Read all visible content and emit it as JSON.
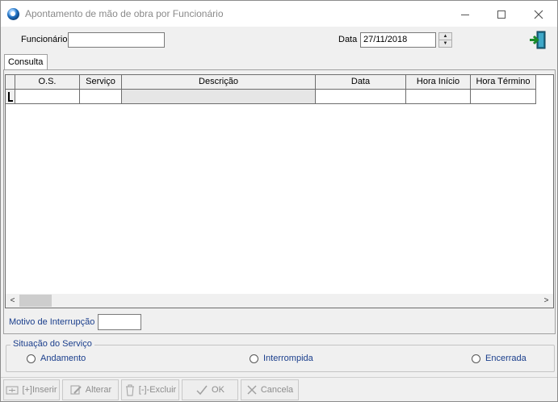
{
  "window": {
    "title": "Apontamento de mão de obra por Funcionário"
  },
  "header": {
    "funcionario_label": "Funcionário",
    "funcionario_value": "",
    "data_label": "Data",
    "data_value": "27/11/2018"
  },
  "tabs": [
    {
      "label": "Consulta"
    }
  ],
  "grid": {
    "columns": [
      "O.S.",
      "Serviço",
      "Descrição",
      "Data",
      "Hora Início",
      "Hora Término"
    ],
    "rows": [
      [
        "",
        "",
        "",
        "",
        "",
        ""
      ]
    ]
  },
  "motivo": {
    "label": "Motivo de Interrupção",
    "value": ""
  },
  "situacao": {
    "title": "Situação do Serviço",
    "options": [
      "Andamento",
      "Interrompida",
      "Encerrada"
    ]
  },
  "toolbar": {
    "inserir": "[+]Inserir",
    "alterar": "Alterar",
    "excluir": "[-]-Excluir",
    "ok": "OK",
    "cancela": "Cancela"
  },
  "colors": {
    "label_blue": "#1a3e8c",
    "disabled_text": "#8d8d8d"
  },
  "icons": [
    "app-icon",
    "minimize-icon",
    "maximize-icon",
    "close-icon",
    "exit-door-icon",
    "insert-icon",
    "edit-icon",
    "trash-icon",
    "check-icon",
    "x-icon"
  ]
}
